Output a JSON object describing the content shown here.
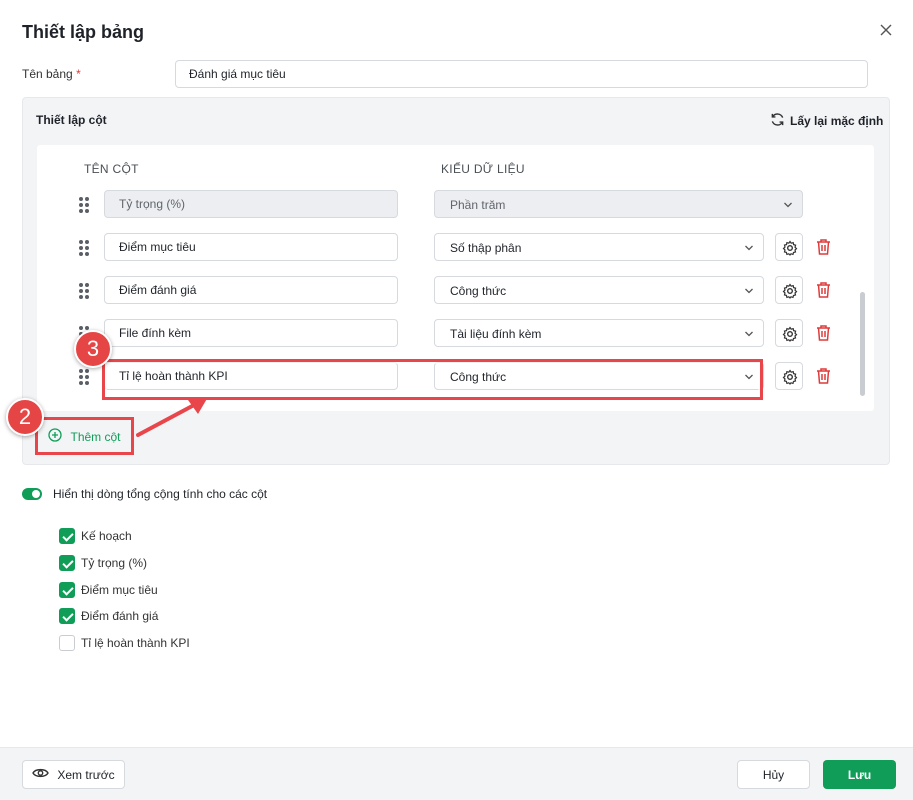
{
  "dialog": {
    "title": "Thiết lập bảng",
    "close_icon": "close-icon"
  },
  "table_name": {
    "label": "Tên bảng",
    "required_mark": "*",
    "value": "Đánh giá mục tiêu"
  },
  "column_settings": {
    "title": "Thiết lập cột",
    "reset_label": "Lấy lại mặc định",
    "header_name": "TÊN CỘT",
    "header_type": "KIỂU DỮ LIỆU",
    "rows": [
      {
        "name": "Tỷ trọng (%)",
        "type": "Phần trăm",
        "disabled": true
      },
      {
        "name": "Điểm mục tiêu",
        "type": "Số thập phân",
        "disabled": false
      },
      {
        "name": "Điểm đánh giá",
        "type": "Công thức",
        "disabled": false
      },
      {
        "name": "File đính kèm",
        "type": "Tài liệu đính kèm",
        "disabled": false
      },
      {
        "name": "Tỉ lệ hoàn thành KPI",
        "type": "Công thức",
        "disabled": false
      }
    ],
    "add_column_label": "Thêm cột"
  },
  "annotations": {
    "badge_2": "2",
    "badge_3": "3"
  },
  "totals": {
    "toggle_label": "Hiển thị dòng tổng cộng tính cho các cột",
    "toggle_on": true,
    "items": [
      {
        "label": "Kế hoạch",
        "checked": true
      },
      {
        "label": "Tỷ trọng (%)",
        "checked": true
      },
      {
        "label": "Điểm mục tiêu",
        "checked": true
      },
      {
        "label": "Điểm đánh giá",
        "checked": true
      },
      {
        "label": "Tỉ lệ hoàn thành KPI",
        "checked": false
      }
    ]
  },
  "footer": {
    "preview_label": "Xem trước",
    "cancel_label": "Hủy",
    "save_label": "Lưu"
  },
  "colors": {
    "accent": "#0f9d58",
    "danger": "#e03a3a",
    "annotation": "#e8464a"
  }
}
